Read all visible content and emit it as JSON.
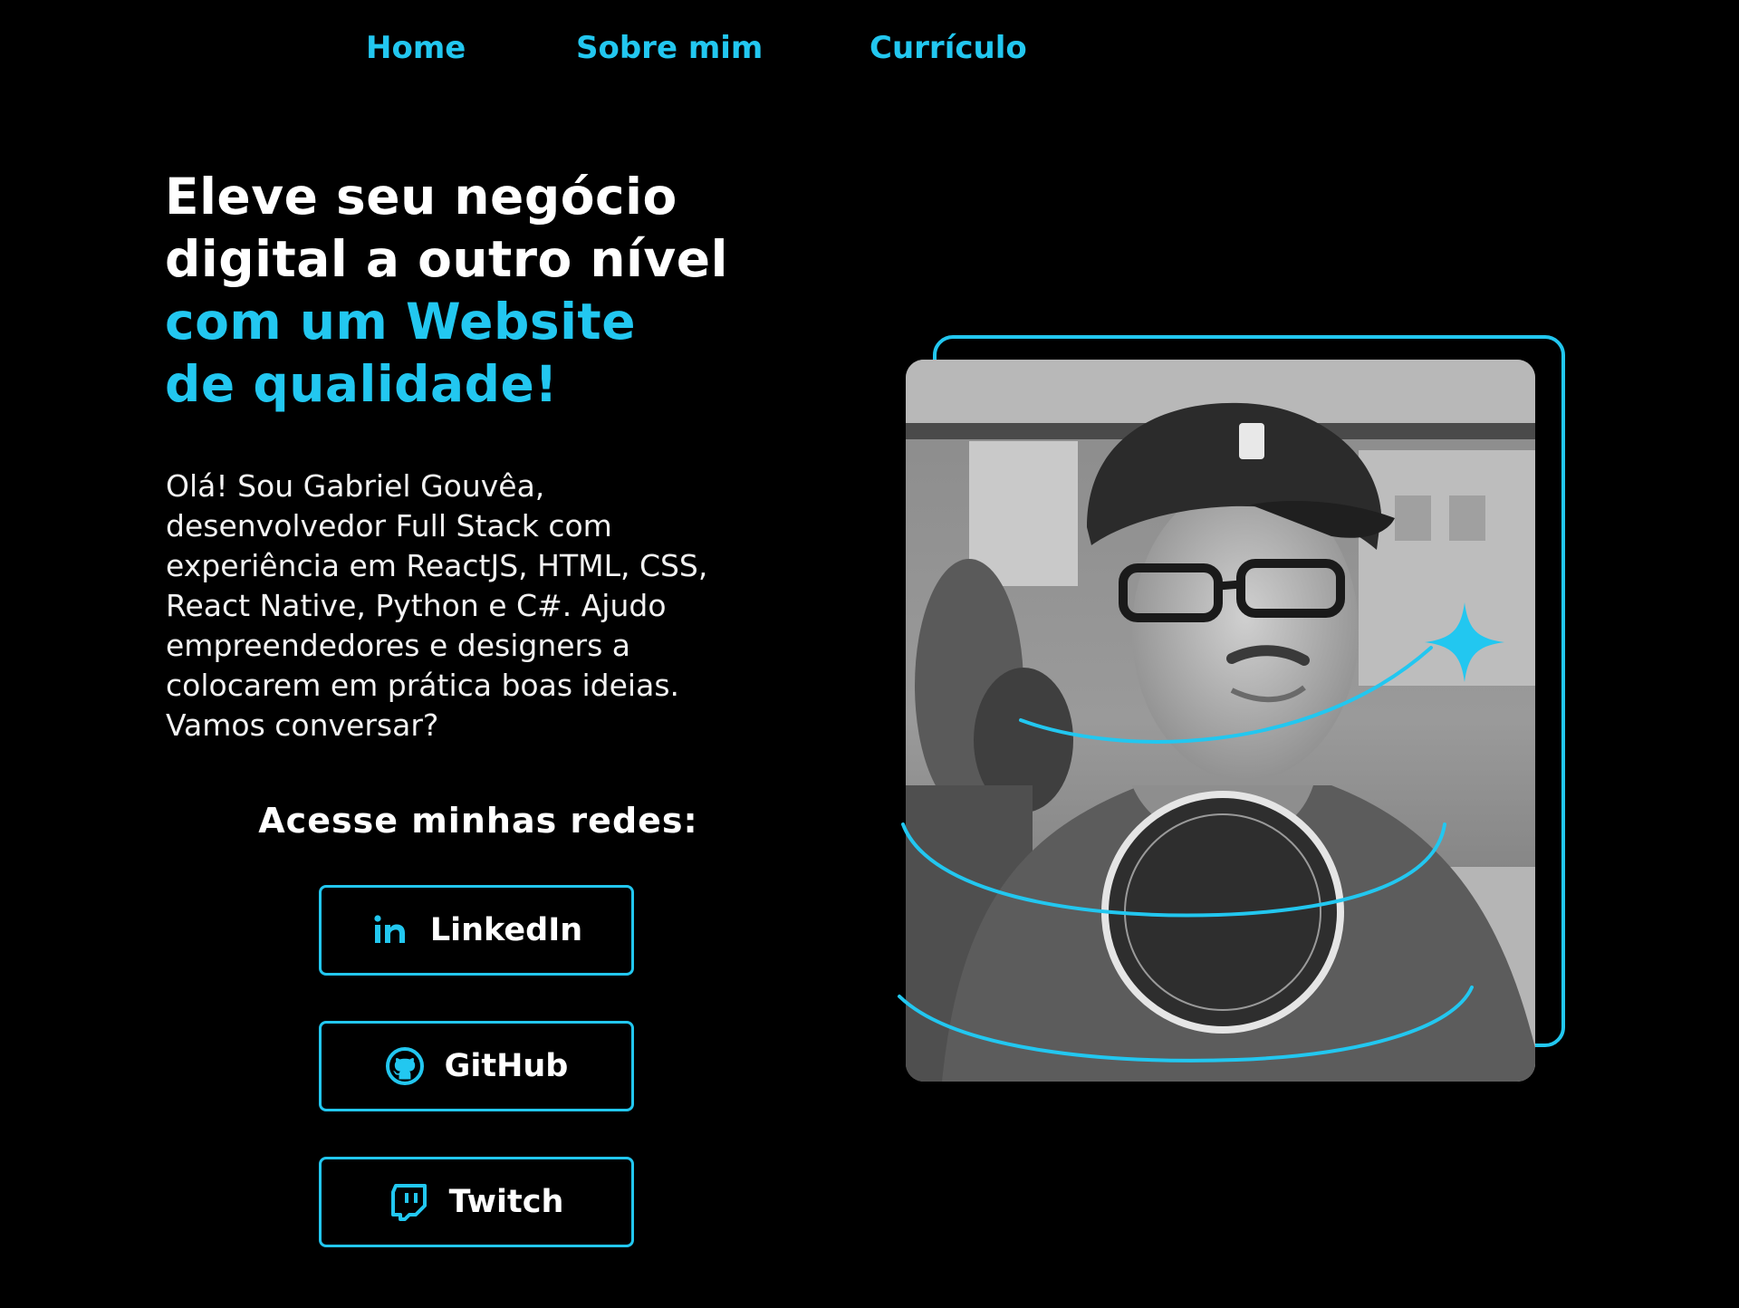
{
  "nav": {
    "items": [
      {
        "label": "Home"
      },
      {
        "label": "Sobre mim"
      },
      {
        "label": "Currículo"
      }
    ]
  },
  "hero": {
    "title_lines": [
      "Eleve seu negócio",
      "digital a outro nível"
    ],
    "title_accent_lines": [
      "com um Website",
      "de qualidade!"
    ],
    "intro_lines": [
      "Olá! Sou Gabriel Gouvêa,",
      "desenvolvedor Full Stack com",
      "experiência em ReactJS, HTML, CSS,",
      "React Native, Python e C#. Ajudo",
      "empreendedores e designers a",
      "colocarem em prática boas ideias.",
      "Vamos conversar?"
    ]
  },
  "social": {
    "heading": "Acesse minhas redes:",
    "buttons": [
      {
        "label": "LinkedIn",
        "icon": "linkedin-icon"
      },
      {
        "label": "GitHub",
        "icon": "github-icon"
      },
      {
        "label": "Twitch",
        "icon": "twitch-icon"
      }
    ]
  },
  "colors": {
    "background": "#000000",
    "accent": "#22c7f0",
    "text": "#ffffff"
  }
}
